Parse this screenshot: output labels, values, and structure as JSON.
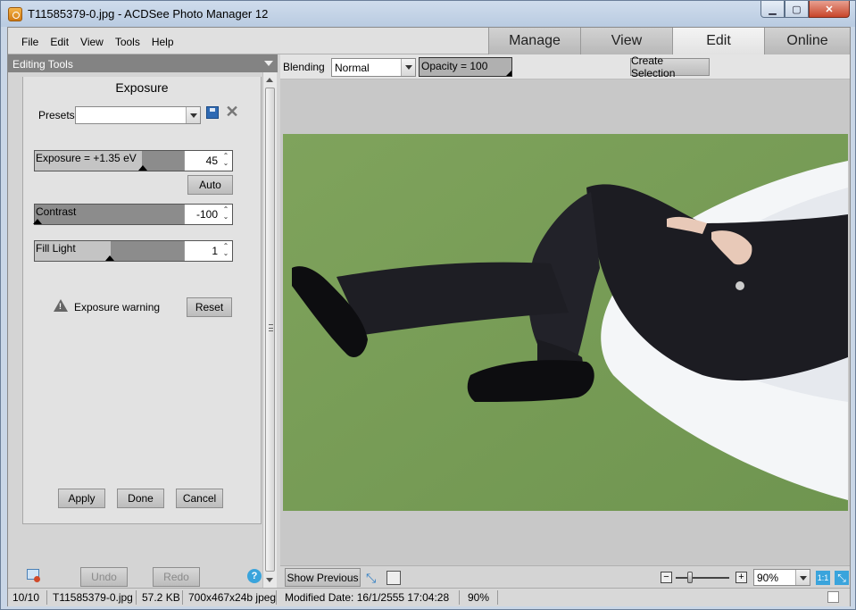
{
  "window": {
    "title": "T11585379-0.jpg - ACDSee Photo Manager 12"
  },
  "menu": {
    "items": [
      "File",
      "Edit",
      "View",
      "Tools",
      "Help"
    ]
  },
  "modes": {
    "manage": "Manage",
    "view": "View",
    "edit": "Edit",
    "online": "Online"
  },
  "left_panel": {
    "header": "Editing Tools",
    "tool_title": "Exposure",
    "presets_label": "Presets",
    "presets_value": "",
    "exposure": {
      "label": "Exposure = +1.35 eV",
      "value": "45"
    },
    "auto_button": "Auto",
    "contrast": {
      "label": "Contrast",
      "value": "-100"
    },
    "fill_light": {
      "label": "Fill Light",
      "value": "1"
    },
    "warning_text": "Exposure warning",
    "reset_button": "Reset",
    "apply_button": "Apply",
    "done_button": "Done",
    "cancel_button": "Cancel",
    "undo_button": "Undo",
    "redo_button": "Redo",
    "help_icon_text": "?"
  },
  "edit_toolbar": {
    "blending_label": "Blending",
    "blending_value": "Normal",
    "opacity_label": "Opacity = 100",
    "create_selection": "Create Selection"
  },
  "view_footer": {
    "show_previous": "Show Previous",
    "zoom_value": "90%",
    "one_to_one": "1:1"
  },
  "status": {
    "position": "10/10",
    "filename": "T11585379-0.jpg",
    "filesize": "57.2 KB",
    "dimensions": "700x467x24b jpeg",
    "modified": "Modified Date: 16/1/2555 17:04:28",
    "zoom": "90%"
  },
  "colors": {
    "panel_header": "#838383",
    "grass": "#7ea05a",
    "active_mode": "#f4f4f4",
    "accent_blue": "#3aa4dc"
  }
}
